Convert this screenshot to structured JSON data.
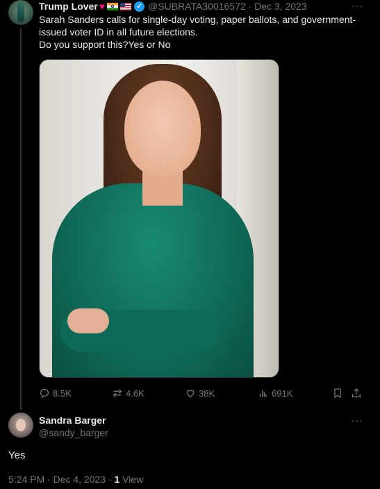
{
  "tweet": {
    "author_name": "Trump Lover",
    "author_handle": "@SUBRATA30016572",
    "date": "Dec 3, 2023",
    "more": "···",
    "text_lines": [
      "Sarah Sanders calls for single-day voting, paper ballots, and government-",
      "issued voter ID in all future elections.",
      "Do you support this?Yes or No"
    ],
    "metrics": {
      "replies": "8.5K",
      "reposts": "4.6K",
      "likes": "38K",
      "views": "691K"
    },
    "icons": [
      "heart-emoji-icon",
      "india-flag-icon",
      "us-flag-icon",
      "verified-badge-icon",
      "reply-icon",
      "repost-icon",
      "like-icon",
      "views-icon",
      "bookmark-icon",
      "share-icon"
    ]
  },
  "reply": {
    "author_name": "Sandra Barger",
    "author_handle": "@sandy_barger",
    "more": "···",
    "text": "Yes",
    "time": "5:24 PM · Dec 4, 2023 · ",
    "views_count": "1",
    "views_label": " View"
  },
  "colors": {
    "background": "#000000",
    "text": "#e7e9ea",
    "muted": "#71767b",
    "verified": "#1d9bf0",
    "heart": "#f91880"
  }
}
